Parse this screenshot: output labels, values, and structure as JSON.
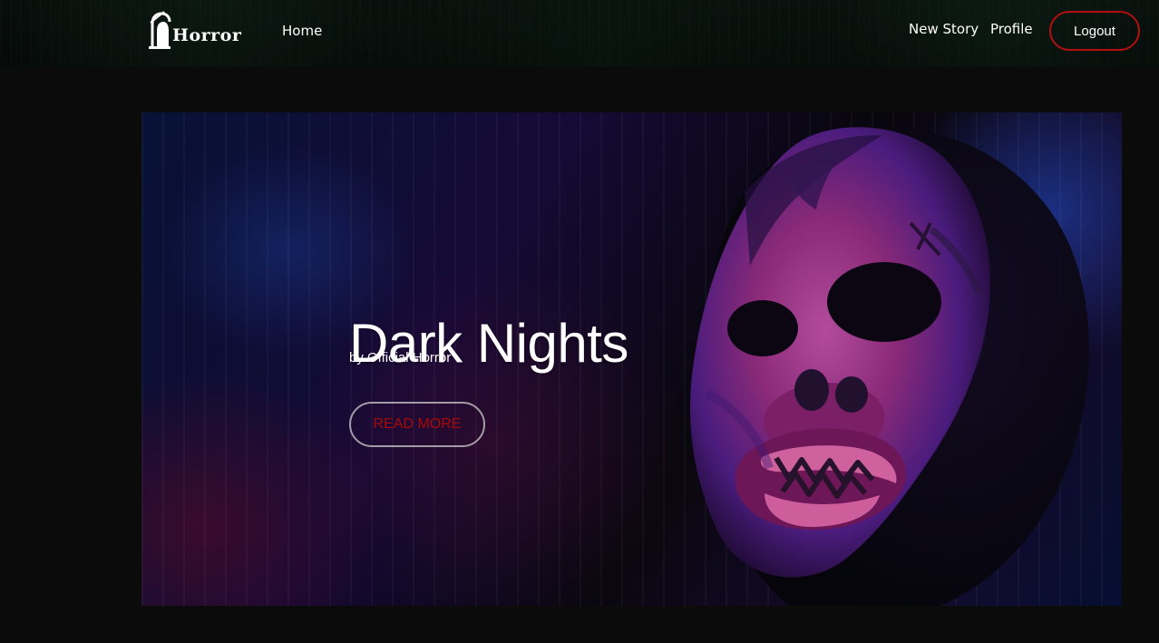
{
  "brand": {
    "name": "Horror",
    "logo_icon": "reaper-icon"
  },
  "nav": {
    "home": "Home",
    "new_story": "New Story",
    "profile": "Profile",
    "logout": "Logout"
  },
  "hero": {
    "title": "Dark Nights",
    "author": "by Official Horror",
    "cta": "READ MORE",
    "image": "masked-figure-image"
  },
  "colors": {
    "background": "#0b0b0b",
    "accent_red": "#b30f0f",
    "cta_text_red": "#a90808"
  }
}
